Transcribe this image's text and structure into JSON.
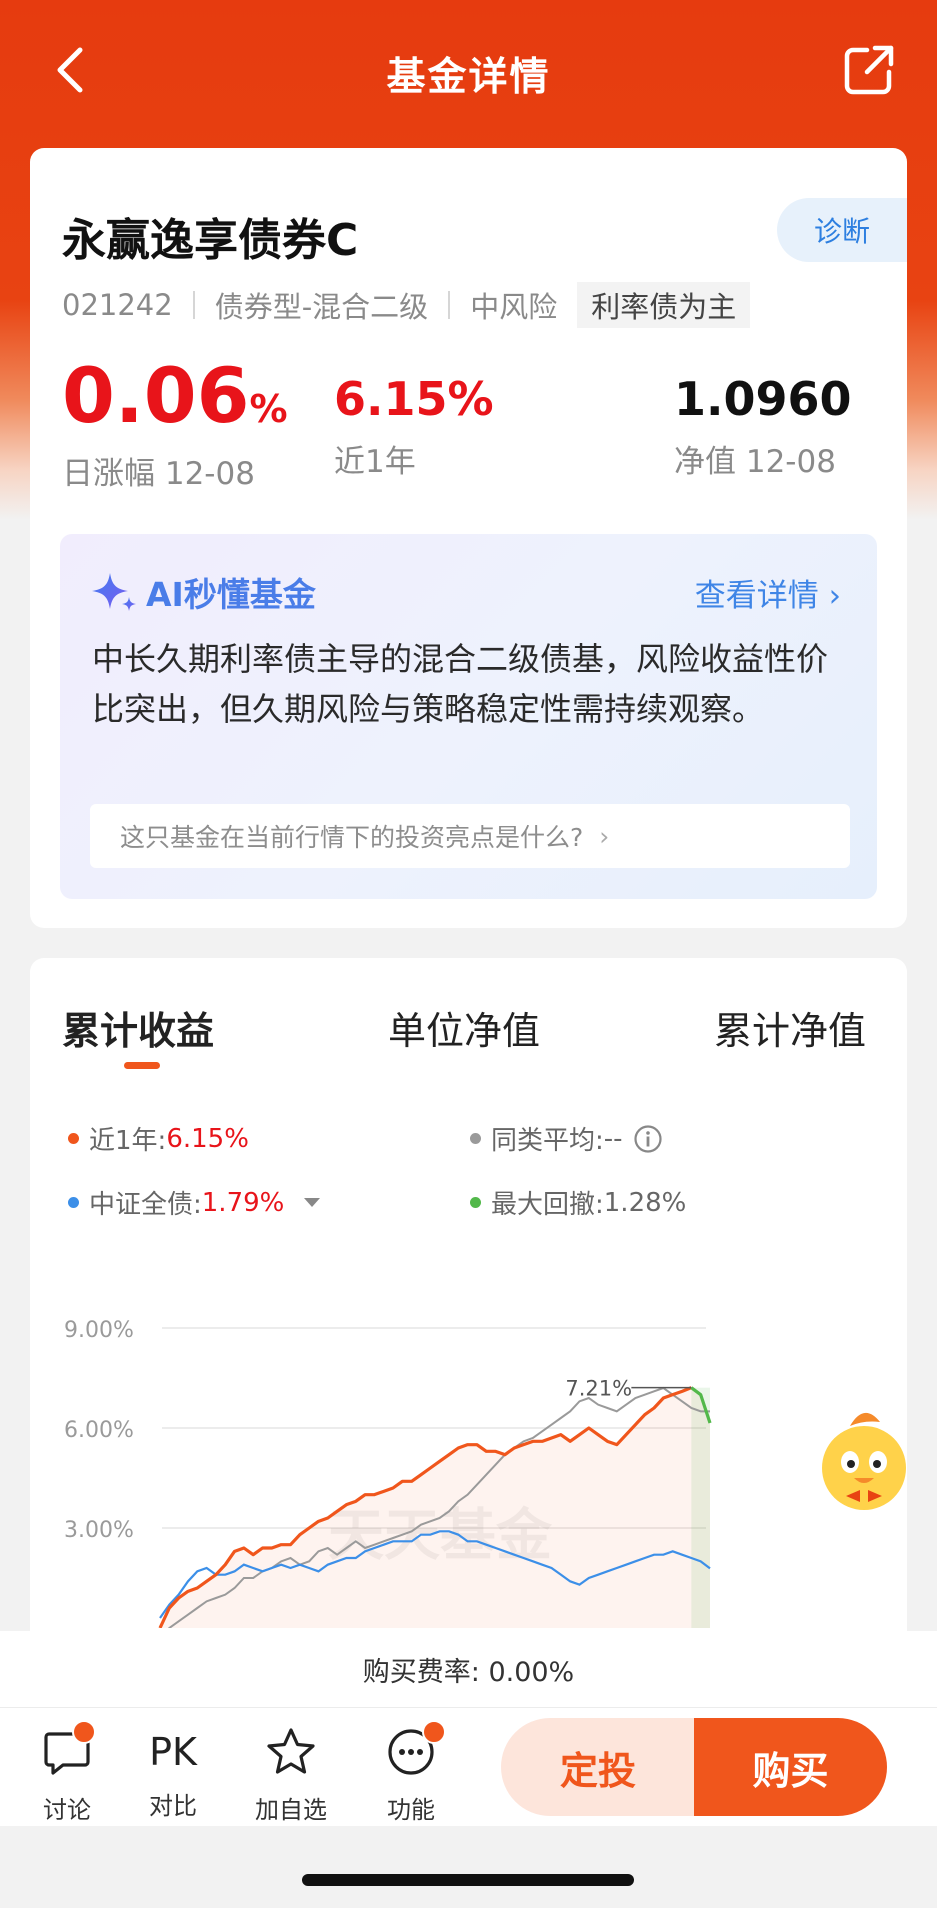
{
  "header": {
    "title": "基金详情"
  },
  "fund": {
    "name": "永赢逸享债券C",
    "code": "021242",
    "type": "债券型-混合二级",
    "risk": "中风险",
    "tag": "利率债为主",
    "diagnose_label": "诊断",
    "daily_change_value": "0.06",
    "daily_change_unit": "%",
    "daily_change_label": "日涨幅 12-08",
    "one_year_value": "6.15%",
    "one_year_label": "近1年",
    "nav_value": "1.0960",
    "nav_label": "净值 12-08"
  },
  "ai": {
    "title": "AI秒懂基金",
    "more_label": "查看详情",
    "summary": "中长久期利率债主导的混合二级债基，风险收益性价比突出，但久期风险与策略稳定性需持续观察。",
    "question": "这只基金在当前行情下的投资亮点是什么?"
  },
  "chart_tabs": [
    "累计收益",
    "单位净值",
    "累计净值"
  ],
  "legend": {
    "fund_label": "近1年:",
    "fund_value": "6.15%",
    "avg_label": "同类平均:",
    "avg_value": "--",
    "index_label": "中证全债:",
    "index_value": "1.79%",
    "drawdown_label": "最大回撤:",
    "drawdown_value": "1.28%"
  },
  "colors": {
    "brand": "#f0561c",
    "fund_line": "#f0561c",
    "avg_line": "#9a9a9a",
    "index_line": "#3c8fe8",
    "drawdown": "#52b84a",
    "up_red": "#e8141a"
  },
  "chart_data": {
    "type": "line",
    "ylabel": "",
    "y_ticks": [
      "9.00%",
      "6.00%",
      "3.00%"
    ],
    "ylim": [
      -2.8,
      9.0
    ],
    "watermark": "天天基金",
    "peak_annotation": "7.21%",
    "x_count": 60,
    "series": [
      {
        "name": "近1年",
        "values": [
          0.0,
          0.6,
          0.9,
          1.1,
          1.2,
          1.4,
          1.6,
          1.9,
          2.3,
          2.4,
          2.2,
          2.4,
          2.4,
          2.5,
          2.5,
          2.8,
          3.0,
          3.2,
          3.3,
          3.5,
          3.7,
          3.8,
          4.0,
          4.0,
          4.1,
          4.2,
          4.4,
          4.4,
          4.6,
          4.8,
          5.0,
          5.2,
          5.4,
          5.5,
          5.5,
          5.3,
          5.3,
          5.2,
          5.4,
          5.5,
          5.6,
          5.6,
          5.7,
          5.8,
          5.6,
          5.8,
          6.0,
          5.8,
          5.6,
          5.5,
          5.8,
          6.1,
          6.4,
          6.6,
          6.9,
          7.0,
          7.1,
          7.21,
          7.0,
          6.15
        ]
      },
      {
        "name": "同类平均",
        "values": [
          -0.3,
          0.0,
          0.2,
          0.4,
          0.6,
          0.8,
          0.9,
          1.0,
          1.2,
          1.5,
          1.5,
          1.7,
          1.8,
          2.0,
          2.1,
          1.9,
          2.0,
          2.3,
          2.4,
          2.2,
          2.4,
          2.6,
          2.4,
          2.5,
          2.6,
          2.7,
          2.8,
          2.9,
          3.1,
          3.2,
          3.3,
          3.5,
          3.8,
          4.0,
          4.3,
          4.6,
          4.9,
          5.2,
          5.4,
          5.6,
          5.7,
          5.9,
          6.1,
          6.3,
          6.5,
          6.8,
          6.9,
          6.7,
          6.6,
          6.5,
          6.7,
          6.9,
          7.0,
          7.1,
          7.2,
          7.0,
          6.8,
          6.6,
          6.5,
          6.5
        ]
      },
      {
        "name": "中证全债",
        "values": [
          0.3,
          0.7,
          1.0,
          1.4,
          1.7,
          1.8,
          1.6,
          1.6,
          1.7,
          1.9,
          1.8,
          1.7,
          1.8,
          1.9,
          1.8,
          1.9,
          1.8,
          1.7,
          1.9,
          2.0,
          2.1,
          2.1,
          2.3,
          2.4,
          2.5,
          2.6,
          2.6,
          2.6,
          2.8,
          2.8,
          2.9,
          2.9,
          2.8,
          2.6,
          2.6,
          2.5,
          2.4,
          2.3,
          2.2,
          2.1,
          2.0,
          1.9,
          1.8,
          1.6,
          1.4,
          1.3,
          1.5,
          1.6,
          1.7,
          1.8,
          1.9,
          2.0,
          2.1,
          2.2,
          2.2,
          2.3,
          2.2,
          2.1,
          2.0,
          1.79
        ]
      }
    ],
    "drawdown_start_index": 57
  },
  "fee": {
    "label": "购买费率: 0.00%"
  },
  "bottom": {
    "discuss": "讨论",
    "pk": "PK",
    "compare": "对比",
    "watch": "加自选",
    "func": "功能",
    "sip": "定投",
    "buy": "购买"
  }
}
